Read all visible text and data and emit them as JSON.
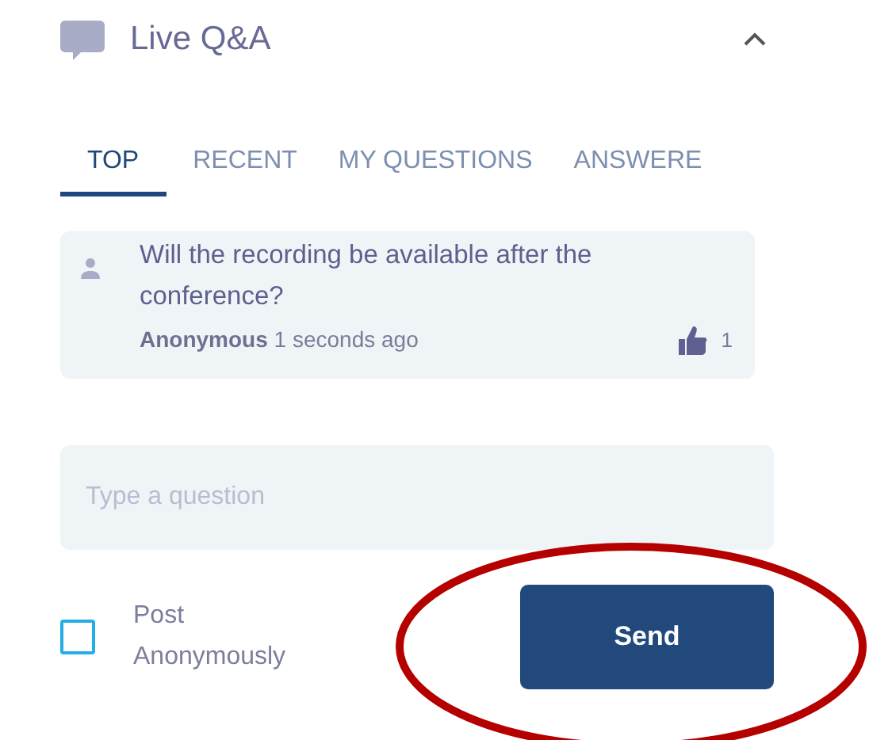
{
  "header": {
    "title": "Live Q&A",
    "expanded": true
  },
  "tabs": [
    {
      "label": "TOP",
      "selected": true
    },
    {
      "label": "RECENT",
      "selected": false
    },
    {
      "label": "MY QUESTIONS",
      "selected": false
    },
    {
      "label": "ANSWERE",
      "selected": false
    }
  ],
  "questions": [
    {
      "text": "Will the recording be available after the conference?",
      "author": "Anonymous",
      "time": "1 seconds ago",
      "likes": "1"
    }
  ],
  "question_field": {
    "placeholder": "Type a question"
  },
  "post_anonymously": {
    "label": "Post Anonymously",
    "checked": false
  },
  "send_button": {
    "label": "Send"
  },
  "annotation": {
    "kind": "ellipse",
    "color": "#b50000"
  }
}
